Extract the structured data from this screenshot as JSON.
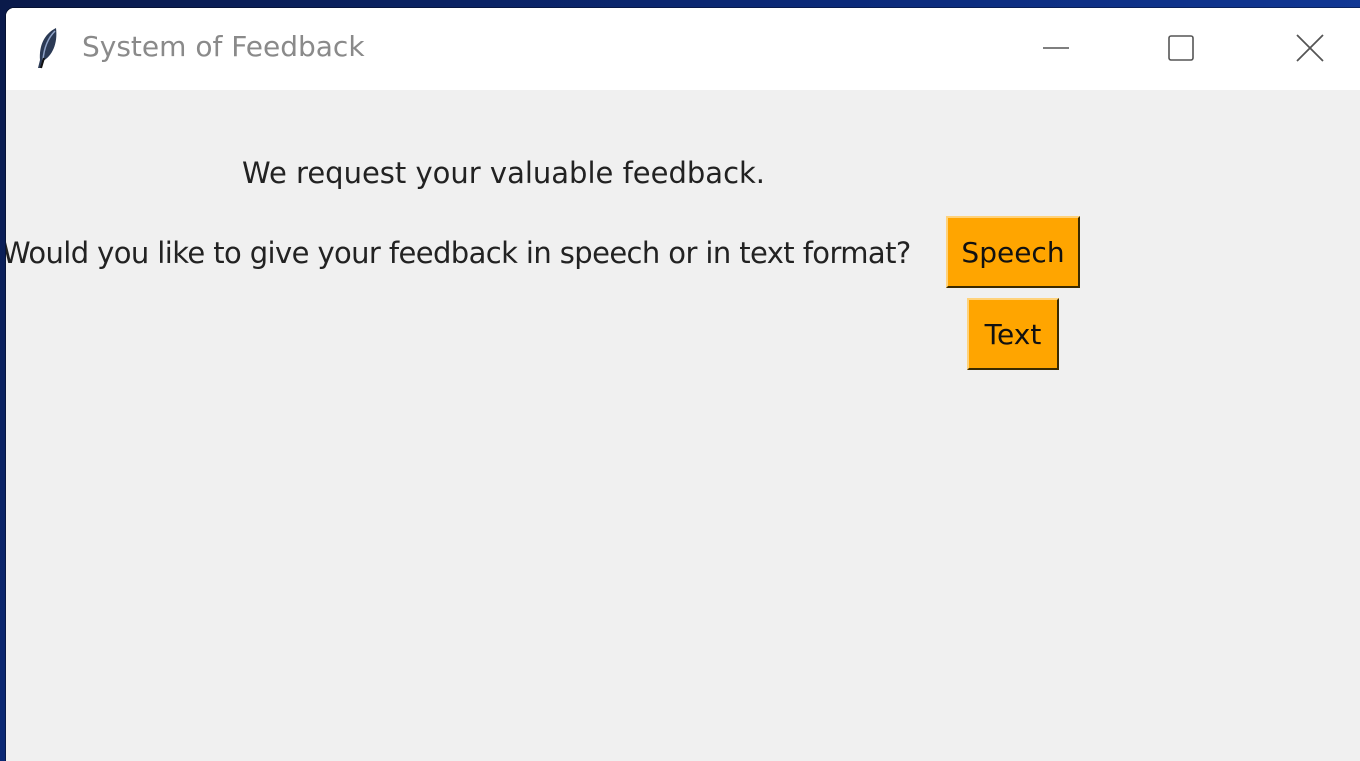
{
  "window": {
    "title": "System of Feedback",
    "icon": "feather-icon",
    "controls": {
      "minimize_icon": "minimize-icon",
      "maximize_icon": "maximize-icon",
      "close_icon": "close-icon"
    }
  },
  "main": {
    "request_text": "We request your valuable feedback.",
    "question_text": "Would you like to give your feedback in speech or in text format?",
    "buttons": {
      "speech_label": "Speech",
      "text_label": "Text"
    }
  },
  "colors": {
    "button_bg": "#ffa500",
    "window_bg": "#f0f0f0",
    "titlebar_bg": "#ffffff"
  }
}
